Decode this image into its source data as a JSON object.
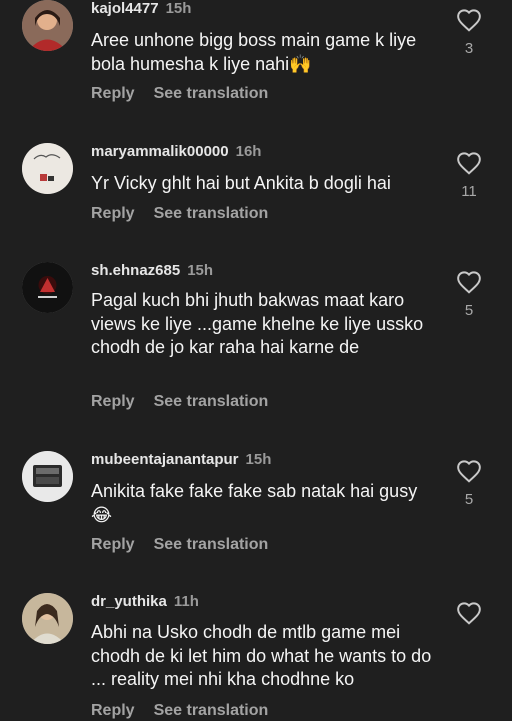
{
  "comments": [
    {
      "username": "kajol4477",
      "time": "15h",
      "text": "Aree unhone bigg boss main game k liye bola humesha k liye nahi🙌",
      "likes": "3",
      "reply_label": "Reply",
      "translation_label": "See translation"
    },
    {
      "username": "maryammalik00000",
      "time": "16h",
      "text": "Yr Vicky ghlt hai but Ankita b dogli hai",
      "likes": "11",
      "reply_label": "Reply",
      "translation_label": "See translation"
    },
    {
      "username": "sh.ehnaz685",
      "time": "15h",
      "text": "Pagal kuch bhi jhuth bakwas maat karo views ke liye ...game khelne ke liye ussko chodh de jo kar raha hai karne de",
      "likes": "5",
      "reply_label": "Reply",
      "translation_label": "See translation"
    },
    {
      "username": "mubeentajanantapur",
      "time": "15h",
      "text": "Anikita fake fake fake sab natak hai gusy😂",
      "likes": "5",
      "reply_label": "Reply",
      "translation_label": "See translation"
    },
    {
      "username": "dr_yuthika",
      "time": "11h",
      "text": "Abhi na Usko chodh de mtlb game mei chodh de ki let him do what he wants to do ... reality mei nhi kha chodhne ko",
      "likes": "",
      "reply_label": "Reply",
      "translation_label": "See translation"
    }
  ],
  "colors": {
    "background": "#1f1f1f",
    "text": "#f4f4f4",
    "muted": "#a3a3a3"
  },
  "icons": {
    "like": "heart-outline-icon"
  }
}
